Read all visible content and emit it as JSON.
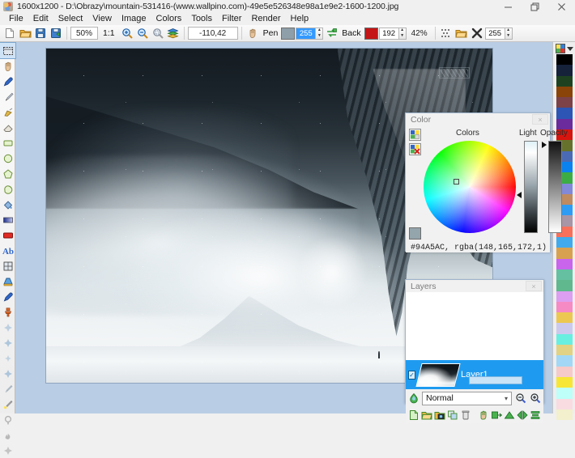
{
  "window": {
    "title": "1600x1200 - D:\\Obrazy\\mountain-531416-(www.wallpino.com)-49e5e526348e98a1e9e2-1600-1200.jpg",
    "app_icon": "palette-icon",
    "minimize": "minimize-icon",
    "maximize": "maximize-icon",
    "close": "close-icon"
  },
  "menubar": {
    "items": [
      {
        "label": "File"
      },
      {
        "label": "Edit"
      },
      {
        "label": "Select"
      },
      {
        "label": "View"
      },
      {
        "label": "Image"
      },
      {
        "label": "Colors"
      },
      {
        "label": "Tools"
      },
      {
        "label": "Filter"
      },
      {
        "label": "Render"
      },
      {
        "label": "Help"
      }
    ]
  },
  "toolbar": {
    "new_icon": "new-document-icon",
    "open_icon": "open-folder-icon",
    "save_icon": "save-disk-icon",
    "saveas_icon": "save-as-icon",
    "zoom_value": "50%",
    "actual_size": "1:1",
    "zoom_in_icon": "zoom-in-icon",
    "zoom_out_icon": "zoom-out-icon",
    "zoom_fit_icon": "zoom-selection-icon",
    "layers_icon": "layers-stack-icon",
    "coordinates": "-110,42",
    "hand_icon": "hand-pan-icon",
    "pen_label": "Pen",
    "pen_color": "#8f9fa9",
    "pen_alpha": "255",
    "swap_icon": "swap-colors-icon",
    "back_label": "Back",
    "back_color": "#c41616",
    "back_alpha": "192",
    "opacity_percent": "42%",
    "dither_icon": "dither-pattern-icon",
    "open2_icon": "open-palette-icon",
    "delete_icon": "delete-x-icon",
    "tolerance": "255"
  },
  "tools": {
    "items": [
      {
        "name": "rectangle-select-tool",
        "active": true
      },
      {
        "name": "pan-hand-tool",
        "active": false
      },
      {
        "name": "color-picker-tool",
        "active": false
      },
      {
        "name": "paintbrush-tool",
        "active": false
      },
      {
        "name": "airbrush-tool",
        "active": false
      },
      {
        "name": "eraser-tool",
        "active": false
      },
      {
        "name": "rectangle-shape-tool",
        "active": false
      },
      {
        "name": "ellipse-shape-tool",
        "active": false
      },
      {
        "name": "polygon-shape-tool",
        "active": false
      },
      {
        "name": "freeform-shape-tool",
        "active": false
      },
      {
        "name": "paint-bucket-tool",
        "active": false
      },
      {
        "name": "gradient-tool",
        "active": false
      },
      {
        "name": "fill-color-tool",
        "active": false
      },
      {
        "name": "text-tool",
        "active": false
      },
      {
        "name": "transform-tool",
        "active": false
      },
      {
        "name": "perspective-tool",
        "active": false
      },
      {
        "name": "eyedropper-tool",
        "active": false
      },
      {
        "name": "clone-stamp-tool",
        "active": false
      },
      {
        "name": "effect-blur-tool",
        "active": false
      },
      {
        "name": "effect-sharpen-tool",
        "active": false
      },
      {
        "name": "effect-smudge-tool",
        "active": false
      },
      {
        "name": "effect-noise-tool",
        "active": false
      },
      {
        "name": "effect-brush-tool",
        "active": false
      },
      {
        "name": "effect-light-tool",
        "active": false
      },
      {
        "name": "effect-dodge-tool",
        "active": false
      },
      {
        "name": "effect-burn-tool",
        "active": false
      },
      {
        "name": "effect-sponge-tool",
        "active": false
      }
    ]
  },
  "palette": {
    "header_icon": "palette-swatch-icon",
    "dropdown_icon": "chevron-down-icon",
    "colors": [
      "#000000",
      "#16213a",
      "#1e4220",
      "#8a4408",
      "#7c4248",
      "#2c55b5",
      "#6b2b9c",
      "#d8140e",
      "#66722c",
      "#4a6ab6",
      "#0a82f0",
      "#3cad45",
      "#8289d8",
      "#c08b61",
      "#2e9cf5",
      "#a895a5",
      "#f8705a",
      "#41aaec",
      "#d8a14f",
      "#c865ec",
      "#64c0a0",
      "#5fb88e",
      "#dc9ef0",
      "#f68ac4",
      "#ecc852",
      "#cbcaee",
      "#68efe0",
      "#e2d283",
      "#a2d8f5",
      "#f6cac8",
      "#f7e636",
      "#befff9",
      "#f8dce2",
      "#f2f0cd"
    ]
  },
  "canvas": {
    "image_title": "mountain photo layer",
    "watermark": "watermark-mark"
  },
  "color_panel": {
    "title": "Color",
    "close_label": "×",
    "colors_label": "Colors",
    "light_label": "Light",
    "opacity_label": "Opacity",
    "hex_rgba": "#94A5AC, rgba(148,165,172,1)",
    "current_color": "#94a5ac",
    "add_swatch_icon": "add-palette-icon",
    "remove_swatch_icon": "remove-palette-icon"
  },
  "layers_panel": {
    "title": "Layers",
    "close_label": "×",
    "layers": [
      {
        "name": "Layer1",
        "visible": true,
        "selected": true
      }
    ],
    "blend_icon": "blend-drop-icon",
    "blend_mode": "Normal",
    "chevron": "⌄",
    "zoom_out_icon": "layer-zoom-out-icon",
    "zoom_in_icon": "layer-zoom-in-icon",
    "buttons": [
      {
        "name": "new-layer-button"
      },
      {
        "name": "open-layer-button"
      },
      {
        "name": "import-layer-button"
      },
      {
        "name": "duplicate-layer-button"
      },
      {
        "name": "delete-layer-button"
      },
      {
        "name": "merge-layer-button"
      },
      {
        "name": "layer-properties-button"
      },
      {
        "name": "flatten-layer-button"
      },
      {
        "name": "flip-horizontal-button"
      },
      {
        "name": "align-layer-button"
      }
    ]
  }
}
